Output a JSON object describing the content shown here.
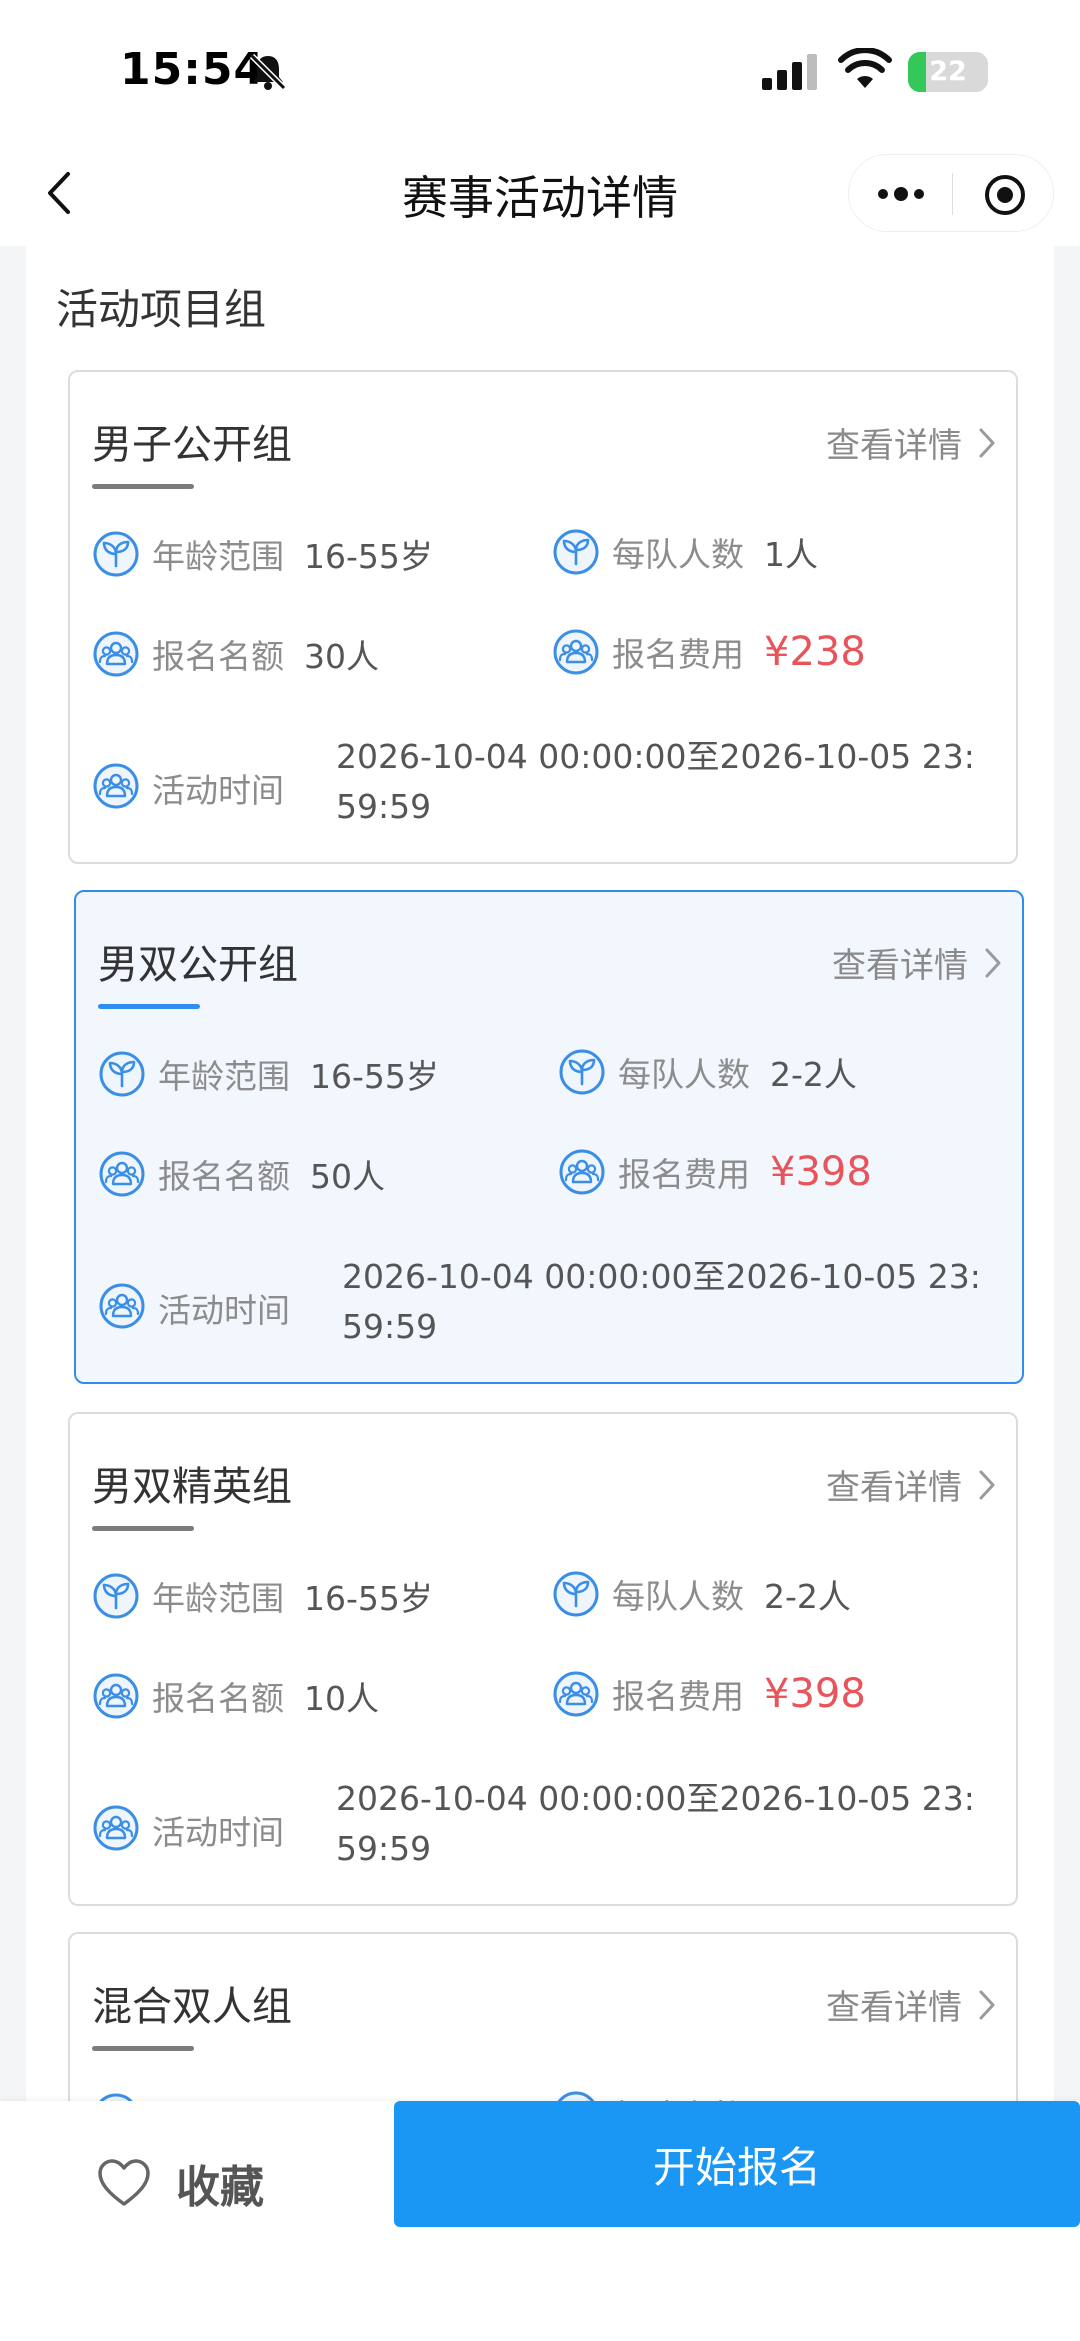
{
  "status_bar": {
    "time": "15:54",
    "battery": "22",
    "battery_level": 0.22
  },
  "nav": {
    "title": "赛事活动详情"
  },
  "section": {
    "title": "活动项目组"
  },
  "labels": {
    "detail": "查看详情",
    "age": "年龄范围",
    "team_size": "每队人数",
    "quota": "报名名额",
    "fee": "报名费用",
    "time": "活动时间"
  },
  "groups": [
    {
      "name": "男子公开组",
      "age": "16-55岁",
      "team_size": "1人",
      "quota": "30人",
      "fee": "¥238",
      "time": "2026-10-04 00:00:00至2026-10-05 23:59:59",
      "selected": false
    },
    {
      "name": "男双公开组",
      "age": "16-55岁",
      "team_size": "2-2人",
      "quota": "50人",
      "fee": "¥398",
      "time": "2026-10-04 00:00:00至2026-10-05 23:59:59",
      "selected": true
    },
    {
      "name": "男双精英组",
      "age": "16-55岁",
      "team_size": "2-2人",
      "quota": "10人",
      "fee": "¥398",
      "time": "2026-10-04 00:00:00至2026-10-05 23:59:59",
      "selected": false
    },
    {
      "name": "混合双人组",
      "selected": false
    }
  ],
  "bottom": {
    "favorite": "收藏",
    "signup": "开始报名"
  },
  "colors": {
    "accent": "#1a97f5",
    "price": "#e8545b",
    "selected_border": "#2f8df0",
    "icon": "#3a8ee6"
  },
  "icons": [
    "bell-slash-icon",
    "signal-icon",
    "wifi-icon",
    "battery-icon",
    "back-icon",
    "more-icon",
    "target-icon",
    "sprout-icon",
    "people-icon",
    "chevron-right-icon",
    "heart-icon"
  ]
}
